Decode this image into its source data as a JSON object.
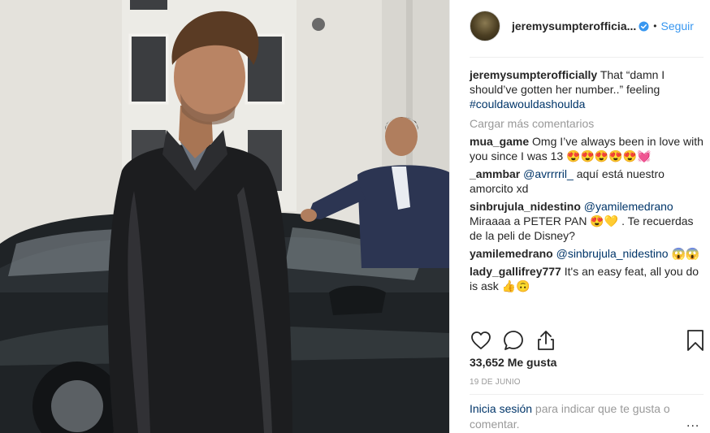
{
  "post": {
    "username": "jeremysumpterofficia...",
    "follow_label": "Seguir",
    "dot": "•",
    "caption": {
      "user": "jeremysumpterofficially",
      "text": "That “damn I should’ve gotten her number..” feeling ",
      "hashtag": "#couldawouldashoulda"
    },
    "load_more": "Cargar más comentarios",
    "comments": [
      {
        "user": "mua_game",
        "text": "Omg I’ve always been in love with you since I was 13 😍😍😍😍😍💓",
        "mention": ""
      },
      {
        "user": "_ammbar",
        "mention": "@avrrrril_",
        "text": " aquí está nuestro amorcito xd"
      },
      {
        "user": "sinbrujula_nidestino",
        "mention": "@yamilemedrano",
        "text": " Miraaaa a PETER PAN 😍💛 . Te recuerdas de la peli de Disney?"
      },
      {
        "user": "yamilemedrano",
        "mention": "@sinbrujula_nidestino",
        "text": " 😱😱"
      },
      {
        "user": "lady_gallifrey777",
        "text": "It's an easy feat, all you do is ask 👍🙃",
        "mention": ""
      }
    ],
    "likes": "33,652 Me gusta",
    "date": "19 DE JUNIO",
    "login": {
      "link": "Inicia sesión",
      "text": " para indicar que te gusta o comentar."
    },
    "more_options": "..."
  },
  "icons": {
    "like": "heart-icon",
    "comment": "comment-icon",
    "share": "share-icon",
    "save": "bookmark-icon",
    "verified": "verified-badge-icon"
  },
  "colors": {
    "link_blue": "#3897f0",
    "hashtag": "#003569",
    "muted": "#999999",
    "text": "#262626"
  }
}
